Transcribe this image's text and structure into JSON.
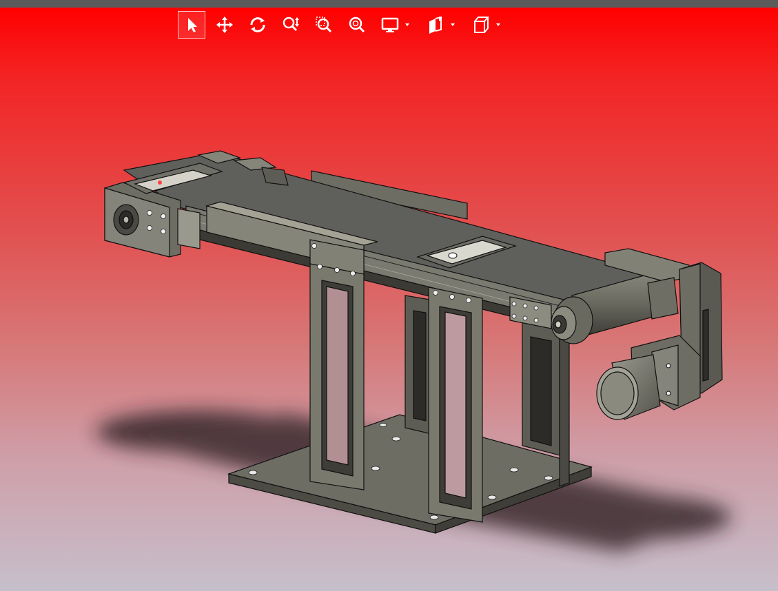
{
  "window": {
    "title": ""
  },
  "toolbar": {
    "items": [
      {
        "icon": "select-arrow-icon",
        "active": true
      },
      {
        "icon": "pan-move-icon",
        "active": false
      },
      {
        "icon": "rotate-icon",
        "active": false
      },
      {
        "icon": "zoom-in-out-icon",
        "active": false
      },
      {
        "icon": "zoom-window-icon",
        "active": false
      },
      {
        "icon": "zoom-fit-icon",
        "active": false
      },
      {
        "icon": "display-style-icon",
        "dropdown": true
      },
      {
        "icon": "section-view-icon",
        "dropdown": true
      },
      {
        "icon": "view-orientation-cube-icon",
        "dropdown": true
      }
    ]
  },
  "viewport": {
    "model": "conveyor-assembly",
    "background_top": "#ff0000",
    "background_bottom": "#c6bfcb",
    "model_color": "#6b6a60",
    "shadow_color": "#2a1e22"
  }
}
